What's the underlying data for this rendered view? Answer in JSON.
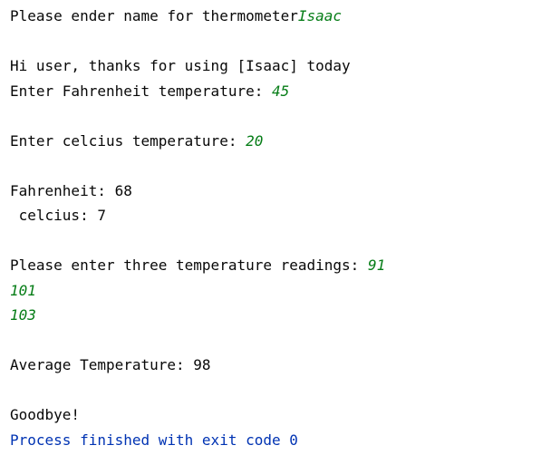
{
  "console": {
    "prompt_name": "Please ender name for thermometer",
    "input_name": "Isaac",
    "greeting": "Hi user, thanks for using [Isaac] today",
    "prompt_fahrenheit": "Enter Fahrenheit temperature: ",
    "input_fahrenheit": "45",
    "prompt_celsius": "Enter celcius temperature: ",
    "input_celsius": "20",
    "result_fahrenheit": "Fahrenheit: 68",
    "result_celsius": " celcius: 7",
    "prompt_readings": "Please enter three temperature readings: ",
    "input_reading_1": "91",
    "input_reading_2": "101",
    "input_reading_3": "103",
    "average": "Average Temperature: 98",
    "goodbye": "Goodbye!",
    "exit_message": "Process finished with exit code 0"
  },
  "colors": {
    "output_text": "#080808",
    "user_input": "#067d17",
    "exit_message": "#0033b3",
    "background": "#ffffff"
  }
}
